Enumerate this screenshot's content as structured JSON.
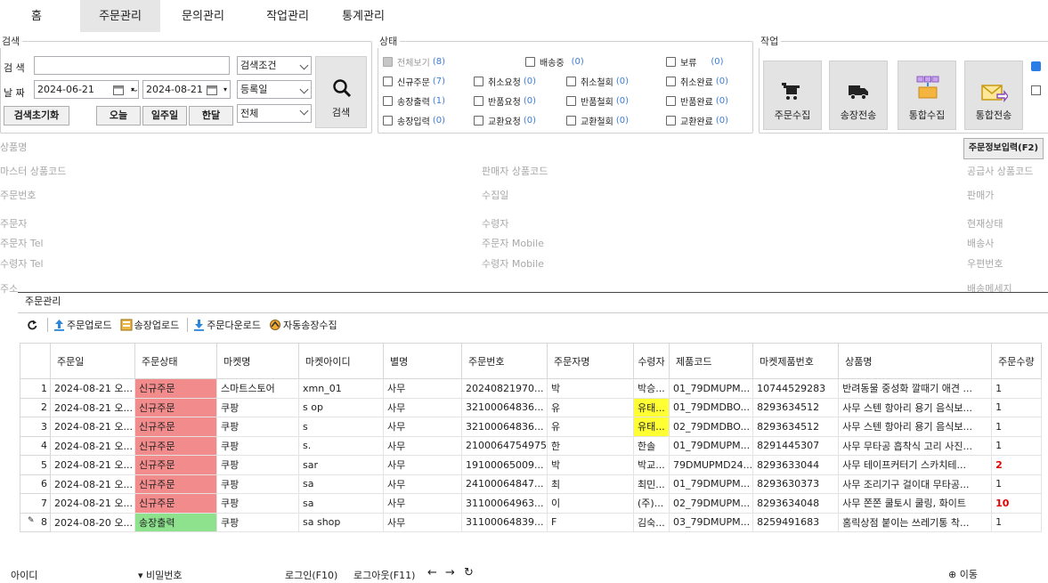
{
  "menu": {
    "items": [
      "홈",
      "주문관리",
      "문의관리",
      "작업관리",
      "통계관리"
    ]
  },
  "search": {
    "legend": "검색",
    "keyword_label": "검 색",
    "keyword_value": "",
    "condition": "검색조건",
    "date_label": "날 짜",
    "date_from": "2024-06-21",
    "date_sep": "~",
    "date_to": "2024-08-21",
    "date_type": "등록일",
    "scope": "전체",
    "search_button": "검색",
    "reset_button": "검색초기화",
    "today_button": "오늘",
    "week_button": "일주일",
    "month_button": "한달"
  },
  "status": {
    "legend": "상태",
    "items": [
      {
        "label": "전체보기",
        "count": "(8)",
        "checked": true,
        "disabled": true
      },
      {
        "label": "배송중",
        "count": "(0)",
        "checked": false
      },
      {
        "label": "보류",
        "count": "(0)",
        "checked": false
      },
      {
        "label": "신규주문",
        "count": "(7)",
        "checked": false
      },
      {
        "label": "취소요청",
        "count": "(0)",
        "checked": false
      },
      {
        "label": "취소철회",
        "count": "(0)",
        "checked": false
      },
      {
        "label": "취소완료",
        "count": "(0)",
        "checked": false
      },
      {
        "label": "송장출력",
        "count": "(1)",
        "checked": false
      },
      {
        "label": "반품요청",
        "count": "(0)",
        "checked": false
      },
      {
        "label": "반품철회",
        "count": "(0)",
        "checked": false
      },
      {
        "label": "반품완료",
        "count": "(0)",
        "checked": false
      },
      {
        "label": "송장입력",
        "count": "(0)",
        "checked": false
      },
      {
        "label": "교환요청",
        "count": "(0)",
        "checked": false
      },
      {
        "label": "교환철회",
        "count": "(0)",
        "checked": false
      },
      {
        "label": "교환완료",
        "count": "(0)",
        "checked": false
      }
    ]
  },
  "work": {
    "legend": "작업",
    "buttons": [
      {
        "label": "주문수집",
        "icon": "cart-icon"
      },
      {
        "label": "송장전송",
        "icon": "truck-icon"
      },
      {
        "label": "통합수집",
        "icon": "boxes-icon"
      },
      {
        "label": "통합전송",
        "icon": "envelope-send-icon"
      }
    ]
  },
  "detail": {
    "fields_left": [
      "상품명",
      "마스터 상품코드",
      "주문번호",
      "주문자",
      "주문자 Tel",
      "수령자 Tel",
      "주소"
    ],
    "fields_mid": [
      "판매자 상품코드",
      "수집일",
      "수령자",
      "주문자 Mobile",
      "수령자 Mobile"
    ],
    "fields_right": [
      "공급사 상품코드",
      "판매가",
      "현재상태",
      "배송사",
      "우편번호",
      "배송메세지"
    ],
    "order_info_button": "주문정보입력(F2)"
  },
  "tab": {
    "label": "주문관리"
  },
  "toolbar": {
    "items": [
      {
        "label": "",
        "icon": "refresh-icon"
      },
      {
        "label": "주문업로드",
        "icon": "upload-icon"
      },
      {
        "label": "송장업로드",
        "icon": "invoice-upload-icon"
      },
      {
        "label": "주문다운로드",
        "icon": "download-icon"
      },
      {
        "label": "자동송장수집",
        "icon": "auto-collect-icon"
      }
    ]
  },
  "grid": {
    "columns": [
      "주문일",
      "주문상태",
      "마켓명",
      "마켓아이디",
      "별명",
      "주문번호",
      "주문자명",
      "수령자",
      "제품코드",
      "마켓제품번호",
      "상품명",
      "주문수량"
    ],
    "rows": [
      {
        "no": "1",
        "date": "2024-08-21 오...",
        "status": "신규주문",
        "status_color": "#f28b8b",
        "market": "스마트스토어",
        "market_id": "xmn_01",
        "alias": "사무",
        "order_no": "20240821970...",
        "orderer": "박",
        "recipient": "박승...",
        "recipient_hl": false,
        "product_code": "01_79DMUPM...",
        "market_product_no": "10744529283",
        "product_name": "반려동물 중성화 깔때기 애견 ...",
        "qty": "1",
        "qty_red": false
      },
      {
        "no": "2",
        "date": "2024-08-21 오...",
        "status": "신규주문",
        "status_color": "#f28b8b",
        "market": "쿠팡",
        "market_id": "s         op",
        "alias": "사무",
        "order_no": "32100064836...",
        "orderer": "유",
        "recipient": "유태...",
        "recipient_hl": true,
        "product_code": "01_79DMDBO...",
        "market_product_no": "8293634512",
        "product_name": "사무 스텐 항아리 용기 음식보...",
        "qty": "1",
        "qty_red": false
      },
      {
        "no": "3",
        "date": "2024-08-21 오...",
        "status": "신규주문",
        "status_color": "#f28b8b",
        "market": "쿠팡",
        "market_id": "s",
        "alias": "사무",
        "order_no": "32100064836...",
        "orderer": "유",
        "recipient": "유태...",
        "recipient_hl": true,
        "product_code": "02_79DMDBO...",
        "market_product_no": "8293634512",
        "product_name": "사무 스텐 항아리 용기 음식보...",
        "qty": "1",
        "qty_red": false
      },
      {
        "no": "4",
        "date": "2024-08-21 오...",
        "status": "신규주문",
        "status_color": "#f28b8b",
        "market": "쿠팡",
        "market_id": "s.",
        "alias": "사무",
        "order_no": "2100064754975",
        "orderer": "한",
        "recipient": "한솔",
        "recipient_hl": false,
        "product_code": "01_79DMUPM...",
        "market_product_no": "8291445307",
        "product_name": "사무 무타공 흡착식 고리 사진...",
        "qty": "1",
        "qty_red": false
      },
      {
        "no": "5",
        "date": "2024-08-21 오...",
        "status": "신규주문",
        "status_color": "#f28b8b",
        "market": "쿠팡",
        "market_id": "sar",
        "alias": "사무",
        "order_no": "19100065009...",
        "orderer": "박",
        "recipient": "박교...",
        "recipient_hl": false,
        "product_code": "79DMUPMD24...",
        "market_product_no": "8293633044",
        "product_name": "사무 테이프커터기 스카치테...",
        "qty": "2",
        "qty_red": true
      },
      {
        "no": "6",
        "date": "2024-08-21 오...",
        "status": "신규주문",
        "status_color": "#f28b8b",
        "market": "쿠팡",
        "market_id": "sa",
        "alias": "사무",
        "order_no": "24100064847...",
        "orderer": "최",
        "recipient": "최민...",
        "recipient_hl": false,
        "product_code": "01_79DMUPM...",
        "market_product_no": "8293630373",
        "product_name": "사무 조리기구 걸이대 무타공...",
        "qty": "1",
        "qty_red": false
      },
      {
        "no": "7",
        "date": "2024-08-21 오...",
        "status": "신규주문",
        "status_color": "#f28b8b",
        "market": "쿠팡",
        "market_id": "sa",
        "alias": "사무",
        "order_no": "31100064963...",
        "orderer": "이",
        "recipient": "(주)...",
        "recipient_hl": false,
        "product_code": "02_79DMUPM...",
        "market_product_no": "8293634048",
        "product_name": "사무 쫀쫀 쿨토시 쿨링, 화이트",
        "qty": "10",
        "qty_red": true
      },
      {
        "no": "8",
        "date": "2024-08-20 오...",
        "status": "송장출력",
        "status_color": "#8ee28e",
        "market": "쿠팡",
        "market_id": "sa       shop",
        "alias": "사무",
        "order_no": "31100064839...",
        "orderer": "F",
        "recipient": "김숙...",
        "recipient_hl": false,
        "product_code": "03_79DMUPM...",
        "market_product_no": "8259491683",
        "product_name": "홈릭상점 붙이는 쓰레기통 착...",
        "qty": "1",
        "qty_red": false
      }
    ]
  },
  "statusbar": {
    "id_label": "아이디",
    "pw_label": "비밀번호",
    "login": "로그인(F10)",
    "logout": "로그아웃(F11)",
    "move": "이동"
  }
}
